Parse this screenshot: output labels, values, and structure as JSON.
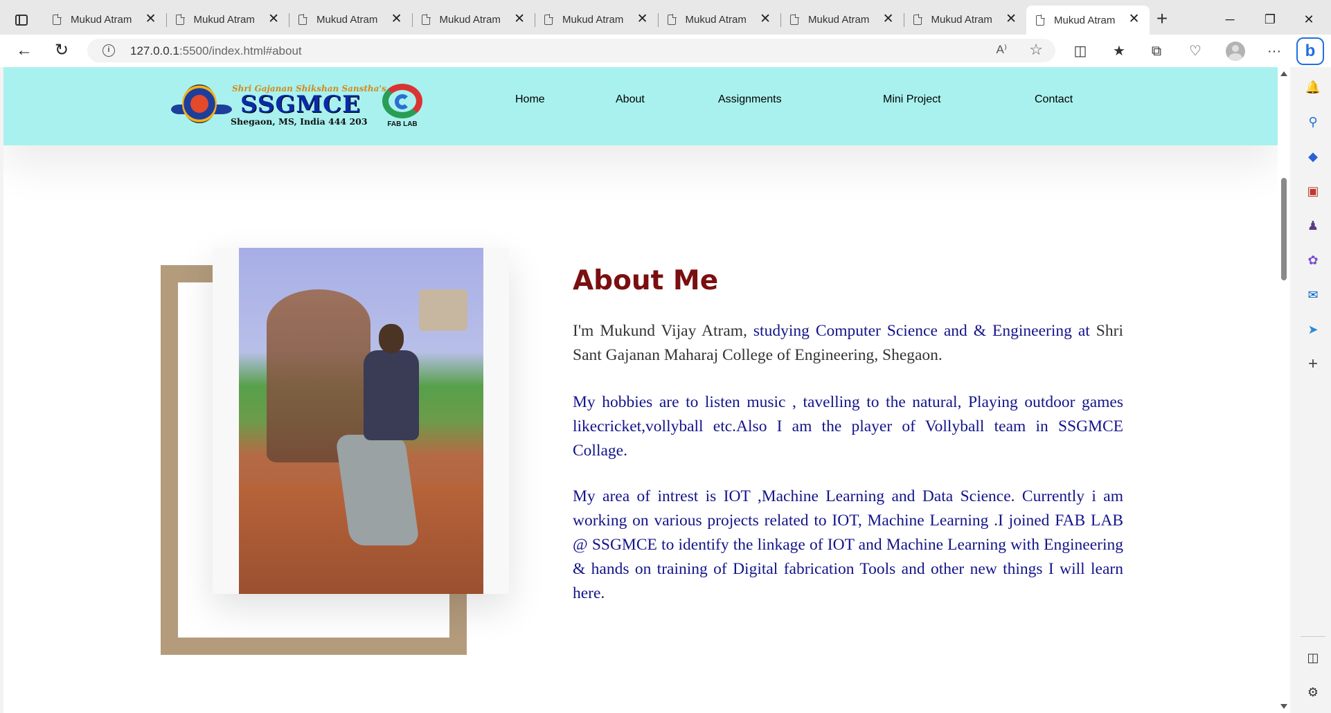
{
  "browser": {
    "tabs": [
      {
        "title": "Mukud Atram"
      },
      {
        "title": "Mukud Atram"
      },
      {
        "title": "Mukud Atram"
      },
      {
        "title": "Mukud Atram"
      },
      {
        "title": "Mukud Atram"
      },
      {
        "title": "Mukud Atram"
      },
      {
        "title": "Mukud Atram"
      },
      {
        "title": "Mukud Atram"
      },
      {
        "title": "Mukud Atram",
        "active": true
      }
    ],
    "tab_close_glyph": "✕",
    "new_tab_glyph": "+",
    "window": {
      "minimize": "─",
      "restore": "❐",
      "close": "✕"
    },
    "address": {
      "host": "127.0.0.1",
      "path": ":5500/index.html#about",
      "read_aloud": "A⁾"
    },
    "more_glyph": "···"
  },
  "site": {
    "logo": {
      "tagline": "Shri Gajanan Shikshan Sanstha's",
      "brand": "SSGMCE",
      "address": "Shegaon, MS, India 444 203"
    },
    "fablab_label": "FAB LAB",
    "nav": [
      {
        "label": "Home"
      },
      {
        "label": "About"
      },
      {
        "label": "Assignments"
      },
      {
        "label": "Mini Project"
      },
      {
        "label": "Contact"
      }
    ],
    "colors": {
      "navbar": "#a9f1ee",
      "title": "#7a0f0f",
      "body_text": "#13138a",
      "frame": "#b39b7c"
    }
  },
  "about": {
    "title": "About Me",
    "p1_dark_a": "I'm Mukund Vijay Atram,",
    "p1_blue": " studying Computer Science and & Engineering at",
    "p1_dark_b": " Shri Sant Gajanan Maharaj College of Engineering, Shegaon.",
    "p2": "My hobbies are to listen music , tavelling to the natural, Playing outdoor games likecricket,vollyball etc.Also I am the player of Vollyball team in SSGMCE Collage.",
    "p3": "My area of intrest is IOT ,Machine Learning and Data Science. Currently i am working on various projects related to IOT, Machine Learning .I joined FAB LAB @ SSGMCE to identify the linkage of IOT and Machine Learning with Engineering & hands on training of Digital fabrication Tools and other new things I will learn here."
  },
  "icons": {
    "sidebar": [
      "bell-icon",
      "search-icon",
      "tag-icon",
      "briefcase-icon",
      "chess-icon",
      "copilot-icon",
      "outlook-icon",
      "send-icon",
      "plus-icon",
      "sidebar-toggle-icon",
      "settings-icon"
    ]
  }
}
